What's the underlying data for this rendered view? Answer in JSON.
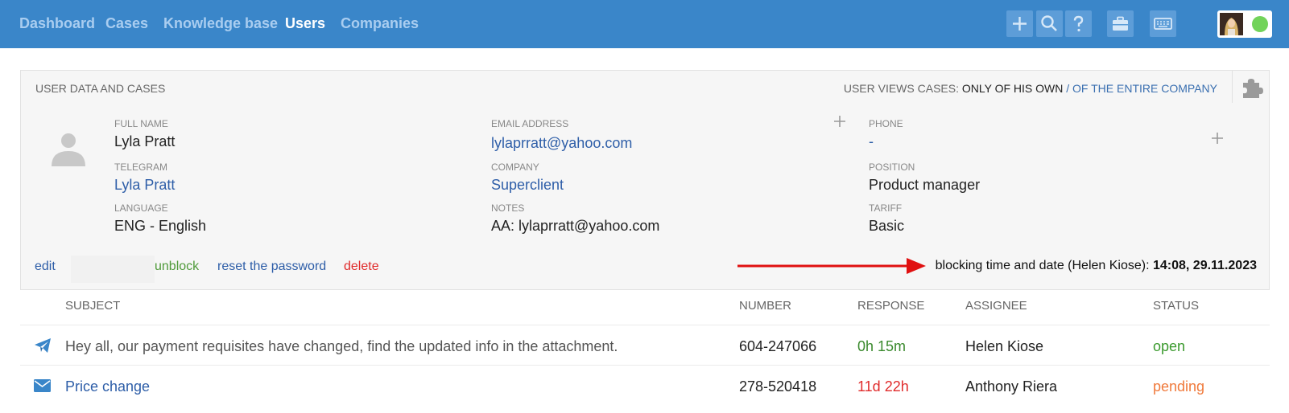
{
  "nav": {
    "items": [
      {
        "label": "Dashboard",
        "active": false
      },
      {
        "label": "Cases",
        "active": false
      },
      {
        "label": "Knowledge base",
        "active": false
      },
      {
        "label": "Users",
        "active": true
      },
      {
        "label": "Companies",
        "active": false
      }
    ],
    "toolbar_icons": [
      "plus-icon",
      "search-icon",
      "help-icon",
      "briefcase-icon",
      "keyboard-icon"
    ],
    "user_status": "online",
    "accent_color": "#3a86c9"
  },
  "panel": {
    "title": "USER DATA AND CASES",
    "views": {
      "label": "USER VIEWS CASES:",
      "own": "ONLY OF HIS OWN",
      "separator": "/",
      "company": "OF THE ENTIRE COMPANY"
    },
    "fields": {
      "full_name": {
        "label": "FULL NAME",
        "value": "Lyla Pratt"
      },
      "email": {
        "label": "EMAIL ADDRESS",
        "value": "lylaprratt@yahoo.com"
      },
      "phone": {
        "label": "PHONE",
        "value": "-"
      },
      "telegram": {
        "label": "TELEGRAM",
        "value": "Lyla Pratt"
      },
      "company": {
        "label": "COMPANY",
        "value": "Superclient"
      },
      "position": {
        "label": "POSITION",
        "value": "Product manager"
      },
      "language": {
        "label": "LANGUAGE",
        "value": "ENG - English"
      },
      "notes": {
        "label": "NOTES",
        "value": "AA: lylaprratt@yahoo.com"
      },
      "tariff": {
        "label": "TARIFF",
        "value": "Basic"
      }
    },
    "actions": {
      "edit": "edit",
      "unblock": "unblock",
      "reset_password": "reset the password",
      "delete": "delete"
    },
    "blocking": {
      "label": "blocking time and date (Helen Kiose):",
      "value": "14:08, 29.11.2023"
    }
  },
  "table": {
    "headers": {
      "subject": "SUBJECT",
      "number": "NUMBER",
      "response": "RESPONSE",
      "assignee": "ASSIGNEE",
      "status": "STATUS"
    },
    "rows": [
      {
        "icon": "telegram-icon",
        "subject": "Hey all, our payment requisites have changed, find the updated info in the attachment.",
        "number": "604-247066",
        "response": "0h 15m",
        "assignee": "Helen Kiose",
        "status": "open"
      },
      {
        "icon": "envelope-icon",
        "subject": "Price change",
        "number": "278-520418",
        "response": "11d 22h",
        "assignee": "Anthony Riera",
        "status": "pending"
      }
    ]
  }
}
